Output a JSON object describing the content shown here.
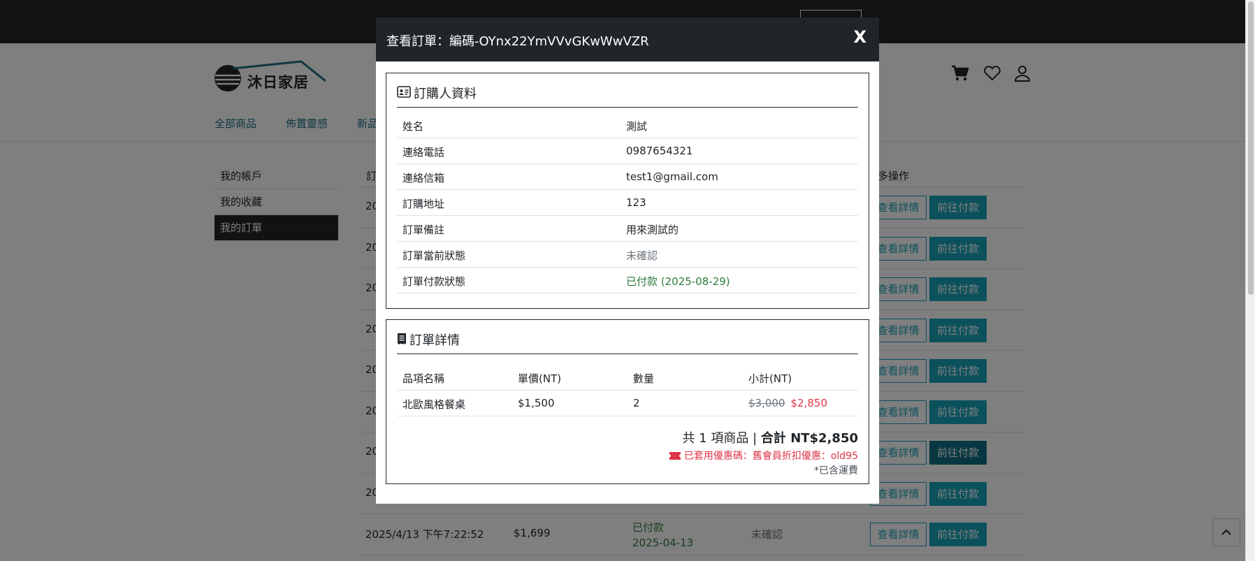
{
  "header": {
    "logo_text": "沐日家居",
    "nav": [
      "全部商品",
      "佈置靈感",
      "新品"
    ]
  },
  "sidebar": {
    "items": [
      "我的帳戶",
      "我的收藏",
      "我的訂單"
    ]
  },
  "orders": {
    "header_first": "訂",
    "header_last": "多操作",
    "rows": [
      {
        "date": "20",
        "amount": "",
        "pay": "",
        "pay_date": "",
        "status": "",
        "view": "查看詳情",
        "pay_btn": "前往付款"
      },
      {
        "date": "20",
        "amount": "",
        "pay": "",
        "pay_date": "",
        "status": "",
        "view": "查看詳情",
        "pay_btn": "前往付款"
      },
      {
        "date": "20",
        "amount": "",
        "pay": "",
        "pay_date": "",
        "status": "",
        "view": "查看詳情",
        "pay_btn": "前往付款"
      },
      {
        "date": "20",
        "amount": "",
        "pay": "",
        "pay_date": "",
        "status": "",
        "view": "查看詳情",
        "pay_btn": "前往付款"
      },
      {
        "date": "20",
        "amount": "",
        "pay": "",
        "pay_date": "",
        "status": "",
        "view": "查看詳情",
        "pay_btn": "前往付款"
      },
      {
        "date": "20",
        "amount": "",
        "pay": "",
        "pay_date": "",
        "status": "",
        "view": "查看詳情",
        "pay_btn": "前往付款"
      },
      {
        "date": "20",
        "amount": "",
        "pay": "",
        "pay_date": "",
        "status": "",
        "view": "查看詳情",
        "pay_btn": "前往付款"
      },
      {
        "date": "20",
        "amount": "",
        "pay": "",
        "pay_date": "",
        "status": "",
        "view": "查看詳情",
        "pay_btn": "前往付款"
      },
      {
        "date": "2025/4/13 下午7:22:52",
        "amount": "$1,699",
        "pay": "已付款",
        "pay_date": "2025-04-13",
        "status": "未確認",
        "view": "查看詳情",
        "pay_btn": "前往付款"
      }
    ]
  },
  "modal": {
    "title": "查看訂單：編碼-OYnx22YmVVvGKwWwVZR",
    "close": "X",
    "buyer_section": {
      "title": "訂購人資料",
      "rows": [
        {
          "label": "姓名",
          "value": "測試"
        },
        {
          "label": "連絡電話",
          "value": "0987654321"
        },
        {
          "label": "連絡信箱",
          "value": "test1@gmail.com"
        },
        {
          "label": "訂購地址",
          "value": "123"
        },
        {
          "label": "訂單備註",
          "value": "用來測試的"
        },
        {
          "label": "訂單當前狀態",
          "value": "未確認"
        },
        {
          "label": "訂單付款狀態",
          "value": "已付款 (2025-08-29)"
        }
      ]
    },
    "detail_section": {
      "title": "訂單詳情",
      "columns": [
        "品項名稱",
        "單價(NT)",
        "數量",
        "小計(NT)"
      ],
      "items": [
        {
          "name": "北歐風格餐桌",
          "price": "$1,500",
          "qty": "2",
          "original_subtotal": "$3,000",
          "subtotal": "$2,850"
        }
      ],
      "total_prefix": "共 1 項商品 | ",
      "total": "合計 NT$2,850",
      "coupon": "已套用優惠碼：舊會員折扣優惠：old95",
      "shipping_note": "*已含運費"
    }
  },
  "colors": {
    "dark": "#212529",
    "accent": "#17a2b8",
    "success": "#2d7a3a",
    "danger": "#dc3545"
  }
}
